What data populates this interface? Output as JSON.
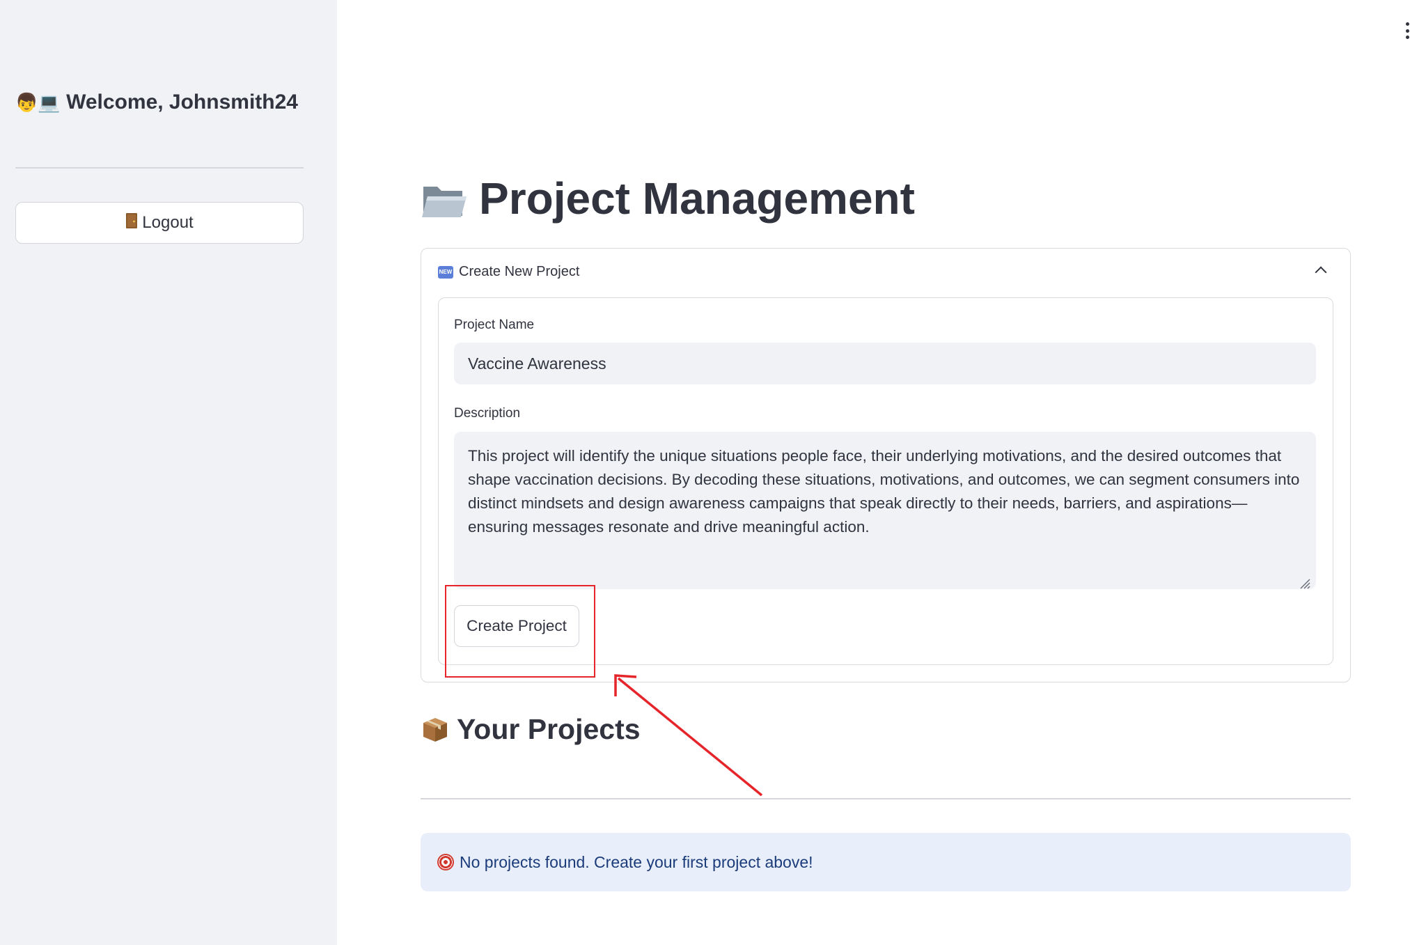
{
  "sidebar": {
    "welcome_text": "Welcome, Johnsmith24",
    "logout_label": "Logout"
  },
  "main": {
    "title": "Project Management",
    "expander": {
      "header": "Create New Project",
      "badge": "NEW",
      "form": {
        "project_name_label": "Project Name",
        "project_name_value": "Vaccine Awareness",
        "description_label": "Description",
        "description_value": "This project will identify the unique situations people face, their underlying motivations, and the desired outcomes that shape vaccination decisions. By decoding these situations, motivations, and outcomes, we can segment consumers into distinct mindsets and design awareness campaigns that speak directly to their needs, barriers, and aspirations—ensuring messages resonate and drive meaningful action.",
        "submit_label": "Create Project"
      }
    },
    "projects_title": "Your Projects",
    "empty_message": "No projects found. Create your first project above!"
  },
  "annotation": {
    "color": "#e5252a"
  },
  "icons": {
    "welcome": [
      "person-icon",
      "laptop-icon"
    ],
    "logout": "door-icon",
    "title": "folder-icon",
    "expander": "new-badge-icon",
    "projects": "package-icon",
    "empty": "target-icon",
    "menu": "more-vertical-icon"
  }
}
